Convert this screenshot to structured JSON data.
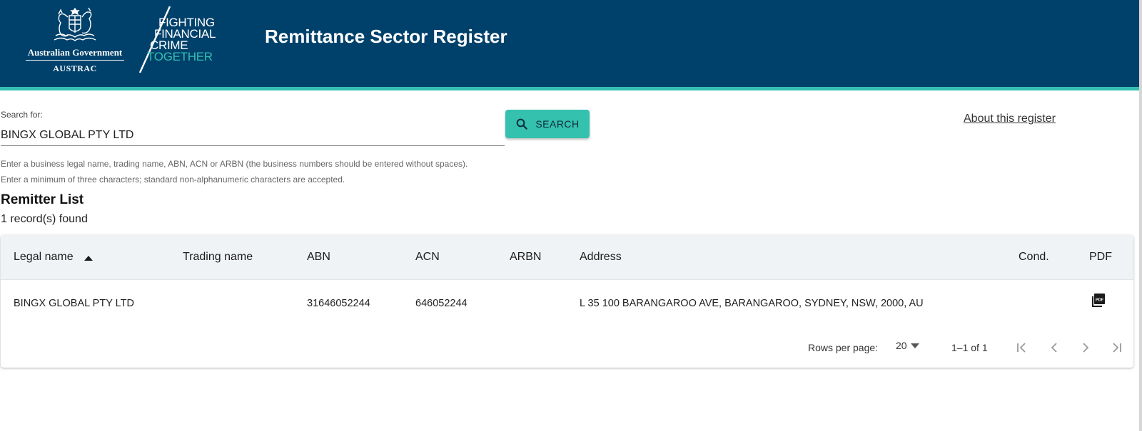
{
  "header": {
    "gov_name": "Australian Government",
    "agency": "AUSTRAC",
    "slogan": [
      "FIGHTING",
      "FINANCIAL",
      "CRIME",
      "TOGETHER"
    ],
    "site_title": "Remittance Sector Register",
    "colors": {
      "header_bg": "#00416b",
      "accent": "#34bfb0"
    }
  },
  "search": {
    "label": "Search for:",
    "value": "BINGX GLOBAL PTY LTD",
    "button_label": "SEARCH",
    "button_icon": "search-icon",
    "help_1": "Enter a business legal name, trading name, ABN, ACN or ARBN (the business numbers should be entered without spaces).",
    "help_2": "Enter a minimum of three characters; standard non-alphanumeric characters are accepted."
  },
  "about_link": "About this register",
  "list": {
    "title": "Remitter List",
    "count_text": "1 record(s) found"
  },
  "table": {
    "columns": [
      "Legal name",
      "Trading name",
      "ABN",
      "ACN",
      "ARBN",
      "Address",
      "Cond.",
      "PDF"
    ],
    "sort": {
      "column": "Legal name",
      "direction": "ascending"
    },
    "rows": [
      {
        "legal_name": "BINGX GLOBAL PTY LTD",
        "trading_name": "",
        "abn": "31646052244",
        "acn": "646052244",
        "arbn": "",
        "address": "L 35 100 BARANGAROO AVE, BARANGAROO, SYDNEY, NSW, 2000, AU",
        "cond": "",
        "pdf_icon": "picture-as-pdf-icon"
      }
    ]
  },
  "pagination": {
    "rows_per_page_label": "Rows per page:",
    "rows_per_page": "20",
    "range": "1–1 of 1"
  }
}
